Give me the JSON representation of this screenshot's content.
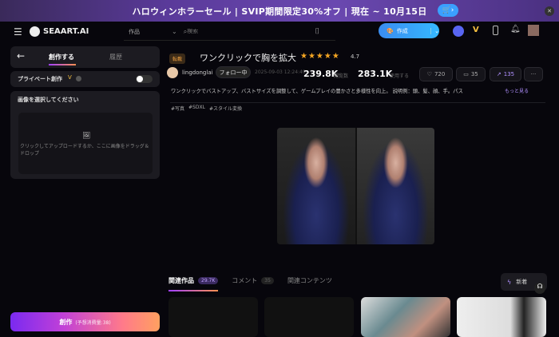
{
  "banner": {
    "text": "ハロウィンホラーセール | SVIP期間限定30%オフ | 現在 ~ 10月15日",
    "cart_label": "🛒›"
  },
  "header": {
    "logo": "SEAART.AI",
    "category": "作品",
    "search_placeholder": "検索",
    "create_label": "作成"
  },
  "left": {
    "tabs": [
      "創作する",
      "履歴"
    ],
    "private_label": "プライベート創作",
    "private_enabled": false,
    "select_title": "画像を選択してください",
    "upload_hint": "クリックしてアップロードするか、ここに画像をドラッグ＆ドロップ",
    "create_button": "創作",
    "create_cost": "(予想消費量:38)"
  },
  "work": {
    "badge": "転載",
    "title": "ワンクリックで胸を拡大",
    "rating": 4.7,
    "rating_text": "4.7",
    "author": "lingdonglai",
    "follow_label": "フォロー中",
    "date": "2025-09-03 12:24:49",
    "views": "239.8K",
    "views_label": "閲覧数",
    "uses": "283.1K",
    "uses_label": "使用する",
    "likes": "720",
    "comments": "35",
    "shares": "135",
    "more": "···",
    "description": "ワンクリックでバストアップ、バストサイズを調整して、ゲームプレイの豊かさと多様性を向上。 説明例：頭、髪、顔、手。パス",
    "show_more": "もっと見る",
    "tags": [
      "#写真",
      "#SDXL",
      "#スタイル変換"
    ]
  },
  "bottom": {
    "tabs": [
      {
        "label": "関連作品",
        "count": "29.7K"
      },
      {
        "label": "コメント",
        "count": "35"
      },
      {
        "label": "関連コンテンツ"
      }
    ],
    "new_label": "新着"
  },
  "colors": {
    "accent": "#a070ff",
    "create": "#3aa0ff",
    "star": "#f5a623"
  }
}
